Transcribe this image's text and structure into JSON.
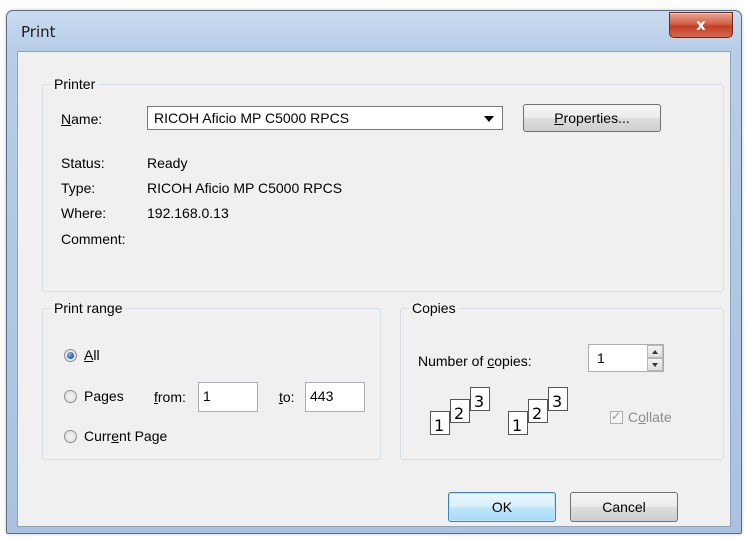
{
  "window": {
    "title": "Print",
    "close_glyph": "x"
  },
  "printer": {
    "group_label": "Printer",
    "name_label": "Name:",
    "name_value": "RICOH Aficio MP C5000 RPCS",
    "properties_button": "Properties...",
    "status_label": "Status:",
    "status_value": "Ready",
    "type_label": "Type:",
    "type_value": "RICOH Aficio MP C5000 RPCS",
    "where_label": "Where:",
    "where_value": "192.168.0.13",
    "comment_label": "Comment:"
  },
  "print_range": {
    "group_label": "Print range",
    "all_label": "All",
    "pages_label": "Pages",
    "from_label": "from:",
    "from_value": "1",
    "to_label": "to:",
    "to_value": "443",
    "current_page_label": "Current Page",
    "selected": "All"
  },
  "copies": {
    "group_label": "Copies",
    "number_label": "Number of copies:",
    "number_value": "1",
    "collate_label": "Collate",
    "collate_checked": true,
    "collate_pages": [
      "1",
      "2",
      "3"
    ]
  },
  "buttons": {
    "ok": "OK",
    "cancel": "Cancel"
  },
  "colors": {
    "title_bar": "#b9cfe9",
    "client_bg": "#f0f0f0",
    "close_button": "#c94a32",
    "default_button": "#bee6fd"
  }
}
